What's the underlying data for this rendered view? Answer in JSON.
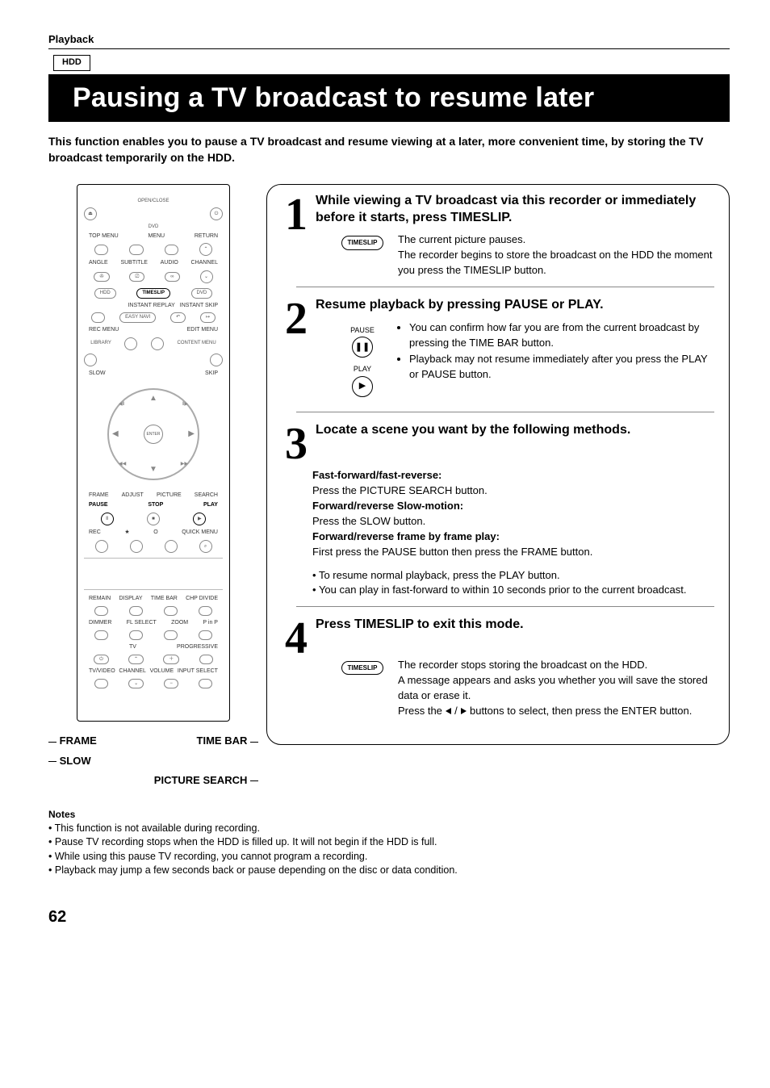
{
  "header": {
    "section": "Playback",
    "tag": "HDD",
    "title": "Pausing a TV broadcast to resume later",
    "intro": "This function enables you to pause a TV broadcast and resume viewing at a later, more convenient time, by storing the TV broadcast temporarily on the HDD."
  },
  "remote": {
    "open_close": "OPEN/CLOSE",
    "dvd": "DVD",
    "top_menu": "TOP MENU",
    "menu": "MENU",
    "return": "RETURN",
    "angle": "ANGLE",
    "subtitle": "SUBTITLE",
    "audio": "AUDIO",
    "channel": "CHANNEL",
    "hdd": "HDD",
    "timeslip": "TIMESLIP",
    "dvd2": "DVD",
    "instant_replay": "INSTANT REPLAY",
    "instant_skip": "INSTANT SKIP",
    "easy_navi": "EASY NAVI",
    "rec_menu": "REC MENU",
    "edit_menu": "EDIT MENU",
    "library": "LIBRARY",
    "content_menu": "CONTENT MENU",
    "enter": "ENTER",
    "slow": "SLOW",
    "skip": "SKIP",
    "frame": "FRAME",
    "adjust": "ADJUST",
    "picture": "PICTURE",
    "search": "SEARCH",
    "pause": "PAUSE",
    "stop": "STOP",
    "play": "PLAY",
    "rec": "REC",
    "star": "★",
    "o": "O",
    "quick_menu": "QUICK MENU",
    "remain": "REMAIN",
    "display": "DISPLAY",
    "time_bar": "TIME BAR",
    "chp_divide": "CHP DIVIDE",
    "dimmer": "DIMMER",
    "fl_select": "FL SELECT",
    "zoom": "ZOOM",
    "pinp": "P in P",
    "tv": "TV",
    "progressive": "PROGRESSIVE",
    "tv_video": "TV/VIDEO",
    "channel2": "CHANNEL",
    "volume": "VOLUME",
    "input_select": "INPUT SELECT"
  },
  "callouts": {
    "frame": "FRAME",
    "time_bar": "TIME BAR",
    "slow": "SLOW",
    "picture_search": "PICTURE SEARCH"
  },
  "steps": {
    "s1": {
      "num": "1",
      "head": "While viewing a TV broadcast via this recorder or immediately before it starts, press TIMESLIP.",
      "btn": "TIMESLIP",
      "text1": "The current picture pauses.",
      "text2": "The recorder begins to store the broadcast on the HDD the moment you press the TIMESLIP button."
    },
    "s2": {
      "num": "2",
      "head": "Resume playback by pressing PAUSE or PLAY.",
      "pause": "PAUSE",
      "play": "PLAY",
      "b1": "You can confirm how far you are from the current broadcast by pressing the TIME BAR button.",
      "b2": "Playback may not resume immediately after you press the PLAY or PAUSE button."
    },
    "s3": {
      "num": "3",
      "head": "Locate a scene you want by the following methods.",
      "l1h": "Fast-forward/fast-reverse:",
      "l1": "Press the PICTURE SEARCH button.",
      "l2h": "Forward/reverse Slow-motion:",
      "l2": "Press the SLOW button.",
      "l3h": "Forward/reverse frame by frame play:",
      "l3": "First press the PAUSE button then press the FRAME button.",
      "n1": "To resume normal playback, press the PLAY button.",
      "n2": "You can play in fast-forward to within 10 seconds prior to the current broadcast."
    },
    "s4": {
      "num": "4",
      "head": "Press TIMESLIP to exit this mode.",
      "btn": "TIMESLIP",
      "t1": "The recorder stops storing the broadcast on the HDD.",
      "t2": "A message appears and asks you whether you will save the stored data or erase it.",
      "t3a": "Press the ",
      "t3b": " buttons to select, then press the ENTER button."
    }
  },
  "notes": {
    "head": "Notes",
    "n1": "This function is not available during recording.",
    "n2": "Pause TV recording stops when the HDD is filled up. It will not begin if the HDD is full.",
    "n3": "While using this pause TV recording, you cannot program a recording.",
    "n4": "Playback may jump a few seconds back or pause depending on the disc or data condition."
  },
  "page": "62"
}
